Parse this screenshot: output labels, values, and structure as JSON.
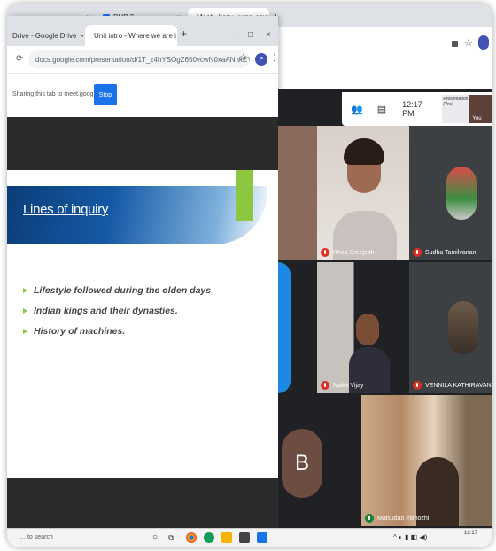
{
  "back_window": {
    "tabs": [
      {
        "label": "…",
        "close": "×"
      },
      {
        "label": "PHP 3",
        "close": "×"
      },
      {
        "label": "Meet - kozy-yump-aew",
        "close": "×"
      }
    ],
    "new_tab": "+"
  },
  "front_window": {
    "tabs": [
      {
        "label": "Drive - Google Drive",
        "close": "×"
      },
      {
        "label": "Unit intro - Where we are i",
        "close": "×"
      }
    ],
    "new_tab": "+",
    "controls": {
      "minimize": "–",
      "maximize": "□",
      "close": "×"
    },
    "url": "docs.google.com/presentation/d/1T_z4hYSOgZ650vcwN0xaANnkEY1rlCVLiedit#sl...",
    "profile_initial": "P",
    "sharing_text": "Sharing this tab to meet.google.com",
    "stop_label": "Stop"
  },
  "slide": {
    "title": "Lines of inquiry",
    "bullets": [
      "Lifestyle followed during the olden days",
      "Indian kings and their dynasties.",
      "History of machines."
    ]
  },
  "meet": {
    "time": "12:17 PM",
    "self_label": "Presentation (You)",
    "you_label": "You",
    "participants": [
      {
        "name": "Rhea Sreejesh"
      },
      {
        "name": "Sudha Tamilvanan"
      },
      {
        "name": "Nalini Vijay"
      },
      {
        "name": "VENNILA KATHIRAVAN"
      },
      {
        "name": "Malsudan Inimozhi"
      }
    ],
    "avatar_letter": "B"
  },
  "taskbar": {
    "search_text": "… to search",
    "tray_time": "12:17"
  },
  "colors": {
    "accent_blue": "#1a73e8",
    "lime": "#8dc63f",
    "meet_bg": "#202124",
    "mic_red": "#d93025"
  }
}
